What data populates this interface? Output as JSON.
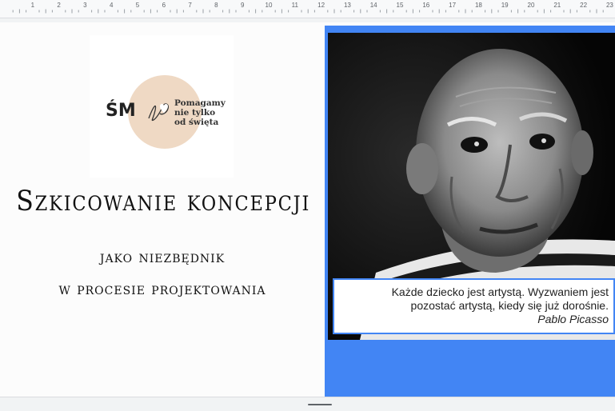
{
  "ruler": {
    "numbers": [
      "1",
      "2",
      "3",
      "4",
      "5",
      "6",
      "7",
      "8",
      "9",
      "10",
      "11",
      "12",
      "13",
      "14",
      "15",
      "16",
      "17",
      "18",
      "19",
      "20",
      "21",
      "22",
      "23"
    ]
  },
  "logo": {
    "initials": "ŚM",
    "lines": [
      "Pomagamy",
      "nie tylko",
      "od święta"
    ],
    "circle_color": "#efd9c4"
  },
  "slide": {
    "title": "Szkicowanie koncepcji",
    "subtitle_line1": "jako niezbędnik",
    "subtitle_line2": "w procesie projektowania",
    "accent_color": "#4285f4"
  },
  "quote": {
    "line1": "Każde dziecko jest artystą. Wyzwaniem jest",
    "line2": "pozostać artystą, kiedy się już dorośnie.",
    "author": "Pablo Picasso"
  }
}
